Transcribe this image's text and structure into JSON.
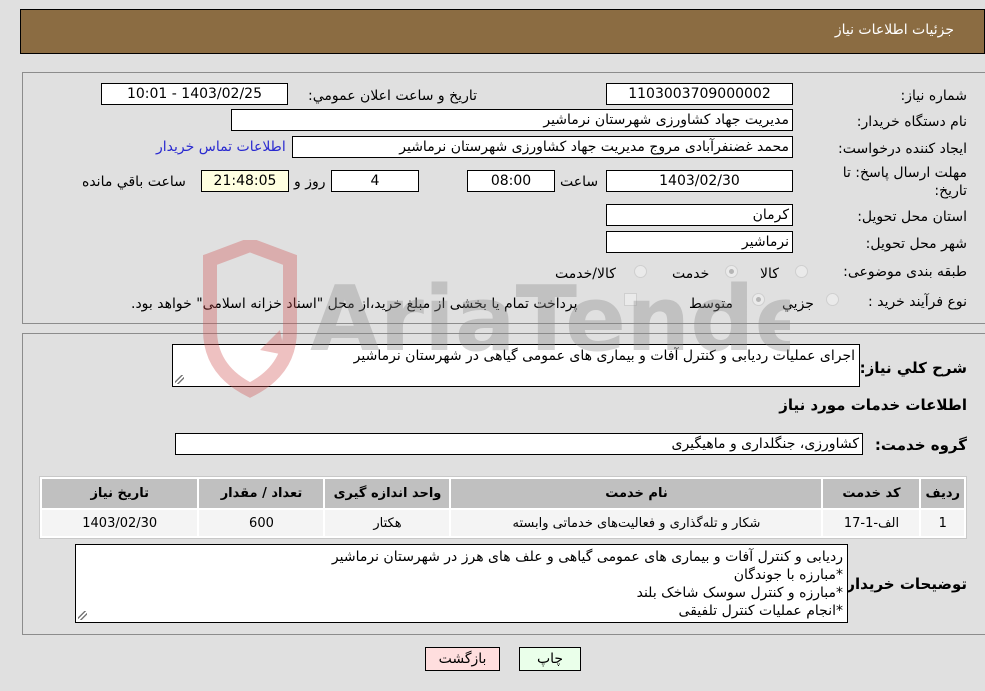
{
  "header": {
    "title": "جزئیات اطلاعات نیاز"
  },
  "form": {
    "need_number": {
      "label": "شماره نیاز:",
      "value": "1103003709000002"
    },
    "announce_datetime": {
      "label": "تاريخ و ساعت اعلان عمومي:",
      "value": "1403/02/25 - 10:01"
    },
    "buyer_org": {
      "label": "نام دستگاه خریدار:",
      "value": "مدیریت جهاد کشاورزی شهرستان نرماشیر"
    },
    "requester": {
      "label": "ایجاد کننده درخواست:",
      "value": "محمد غضنفرآبادی مروج مدیریت جهاد کشاورزی شهرستان نرماشیر"
    },
    "buyer_contact_link": "اطلاعات تماس خریدار",
    "deadline": {
      "label": "مهلت ارسال پاسخ: تا تاریخ:",
      "date": "1403/02/30",
      "time_label": "ساعت",
      "time": "08:00",
      "days": "4",
      "days_label": "روز و",
      "remaining": "21:48:05",
      "remaining_label": "ساعت باقي مانده"
    },
    "province": {
      "label": "استان محل تحویل:",
      "value": "کرمان"
    },
    "city": {
      "label": "شهر محل تحویل:",
      "value": "نرماشیر"
    },
    "category": {
      "label": "طبقه بندی موضوعی:",
      "options": [
        "کالا",
        "خدمت",
        "کالا/خدمت"
      ],
      "selected": "خدمت"
    },
    "purchase_type": {
      "label": "نوع فرآیند خرید :",
      "options": [
        "جزيي",
        "متوسط"
      ],
      "selected": "متوسط",
      "treasury_note": "پرداخت تمام یا بخشی از مبلغ خرید،از محل \"اسناد خزانه اسلامی\" خواهد بود."
    }
  },
  "details": {
    "summary_label": "شرح كلي نياز:",
    "summary_value": "اجرای عملیات ردیابی و کنترل آفات و بیماری های عمومی گیاهی در شهرستان نرماشیر",
    "services_heading": "اطلاعات خدمات مورد نياز",
    "service_group_label": "گروه خدمت:",
    "service_group_value": "کشاورزی، جنگلداری و ماهیگیری",
    "table": {
      "headers": [
        "ردیف",
        "کد خدمت",
        "نام خدمت",
        "واحد اندازه گیری",
        "تعداد / مقدار",
        "تاریخ نیاز"
      ],
      "rows": [
        [
          "1",
          "الف-1-17",
          "شکار و تله‌گذاری و فعالیت‌های خدماتی وابسته",
          "هکتار",
          "600",
          "1403/02/30"
        ]
      ]
    },
    "buyer_notes_label": "توضیحات خریدار:",
    "buyer_notes_lines": [
      "ردیابی و کنترل آفات و بیماری های عمومی گیاهی و علف های هرز در شهرستان نرماشیر",
      "*مبارزه با جوندگان",
      "*مبارزه و کنترل سوسک شاخک بلند",
      "*انجام عملیات کنترل تلفیقی"
    ]
  },
  "buttons": {
    "print": "چاپ",
    "back": "بازگشت"
  },
  "watermark": {
    "text": "AriaTender.neT"
  },
  "colors": {
    "header_bg": "#8b6c42",
    "link": "#2a2ad0",
    "print_bg": "#eaffea",
    "back_bg": "#ffdede",
    "remaining_bg": "#ffffe0"
  }
}
